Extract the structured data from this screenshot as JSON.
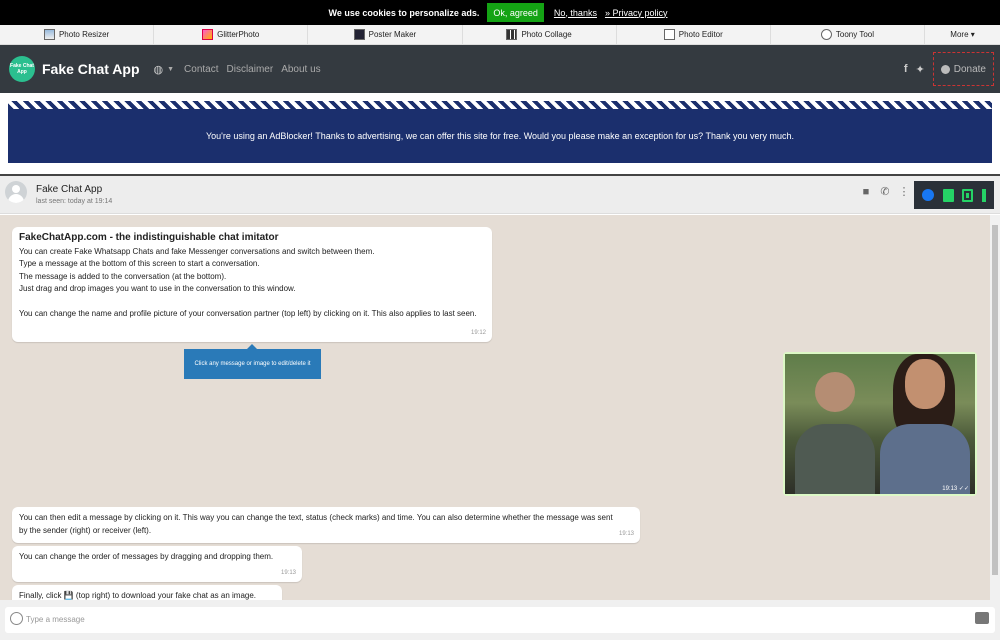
{
  "cookie": {
    "message": "We use cookies to personalize ads.",
    "ok_label": "Ok, agreed",
    "no_label": "No, thanks",
    "privacy_label": "» Privacy policy"
  },
  "tools": [
    {
      "label": "Photo Resizer",
      "icon": "photo-resizer-icon"
    },
    {
      "label": "GlitterPhoto",
      "icon": "glitter-icon"
    },
    {
      "label": "Poster Maker",
      "icon": "poster-icon"
    },
    {
      "label": "Photo Collage",
      "icon": "collage-icon"
    },
    {
      "label": "Photo Editor",
      "icon": "editor-icon"
    },
    {
      "label": "Toony Tool",
      "icon": "toony-icon"
    },
    {
      "label": "More ▾",
      "icon": ""
    }
  ],
  "nav": {
    "brand": "Fake Chat App",
    "logo_text": "Fake Chat App",
    "links": [
      "Contact",
      "Disclaimer",
      "About us"
    ],
    "donate": "Donate"
  },
  "adblock": {
    "text": "You're using an AdBlocker! Thanks to advertising, we can offer this site for free. Would you please make an exception for us? Thank you very much."
  },
  "chat": {
    "name": "Fake Chat App",
    "last_seen": "last seen: today at 19:14",
    "intro": {
      "title": "FakeChatApp.com - the indistinguishable chat imitator",
      "lines": [
        "You can create Fake Whatsapp Chats and fake Messenger conversations and switch between them.",
        "Type a message at the bottom of this screen to start a conversation.",
        "The message is added to the conversation (at the bottom).",
        "Just drag and drop images you want to use in the conversation to this window.",
        "",
        "You can change the name and profile picture of your conversation partner (top left) by clicking on it. This also applies to last seen."
      ],
      "time": "19:12"
    },
    "tooltip": "Click any message or image to edit/delete it",
    "image_time": "19:13 ✓✓",
    "msg2": {
      "text": "You can then edit a message by clicking on it. This way you can change the text, status (check marks) and time. You can also determine whether the message was sent by the sender (right) or receiver (left).",
      "time": "19:13"
    },
    "msg3": {
      "text": "You can change the order of messages by dragging and dropping them.",
      "time": "19:13"
    },
    "msg4": {
      "text": "Finally, click 💾 (top right) to download your fake chat as an image."
    }
  },
  "input": {
    "placeholder": "Type a message"
  },
  "colors": {
    "nav_bg": "#343a40",
    "banner_bg": "#1b2f6d",
    "chat_bg": "#e5ddd5",
    "accent_green": "#25d366",
    "ok_green": "#14a314"
  }
}
